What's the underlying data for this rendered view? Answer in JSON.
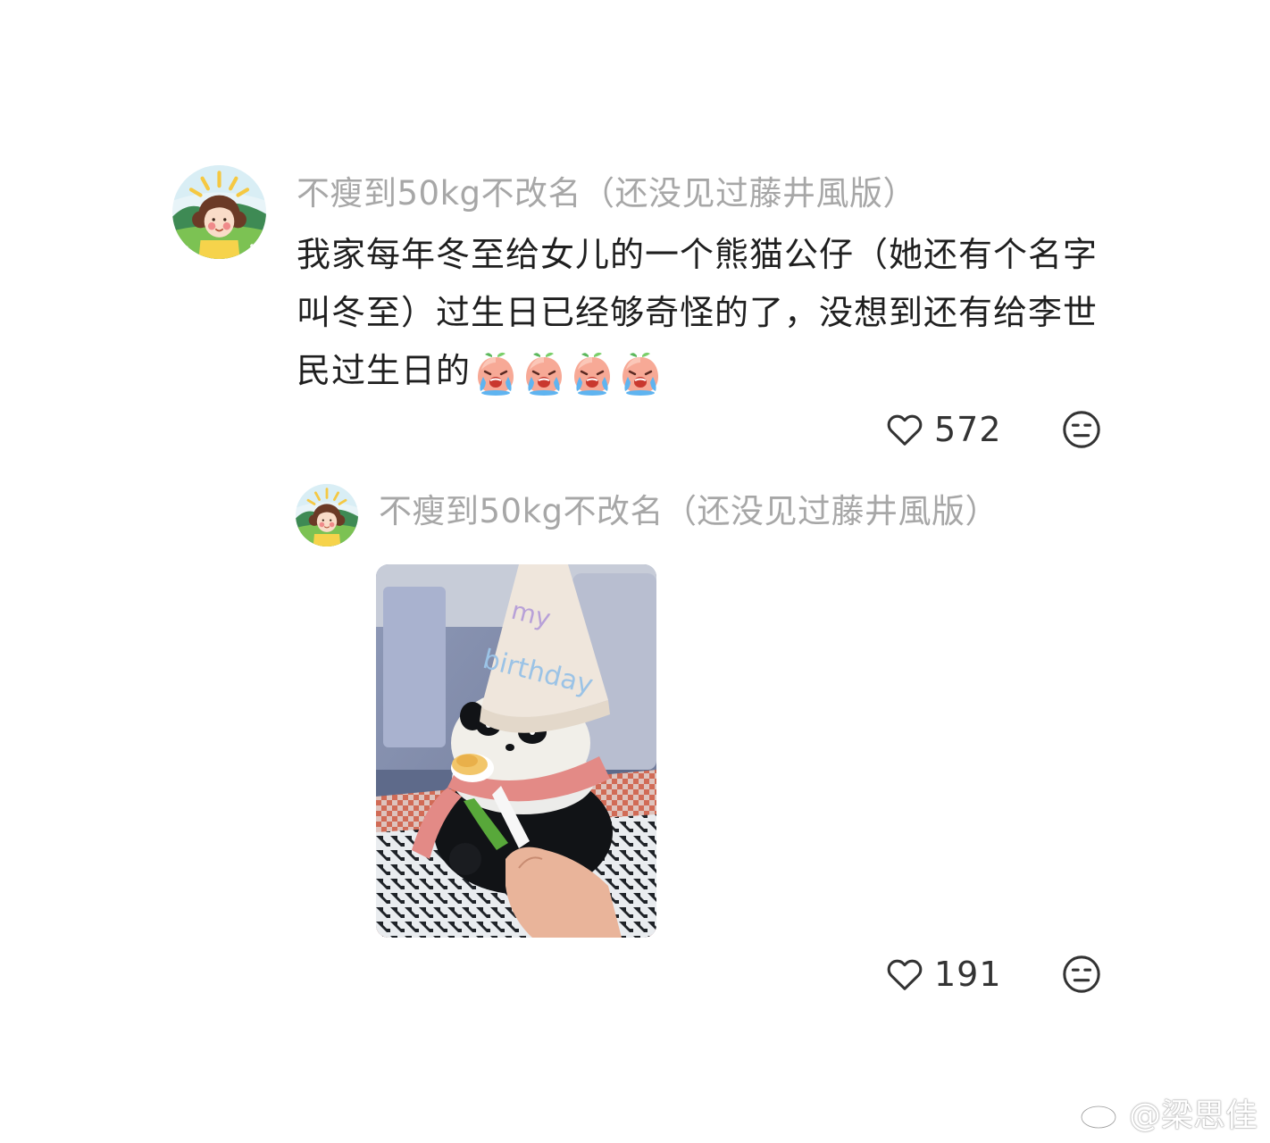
{
  "comments": [
    {
      "username": "不瘦到50kg不改名（还没见过藤井風版）",
      "text": "我家每年冬至给女儿的一个熊猫公仔（她还有个名字叫冬至）过生日已经够奇怪的了，没想到还有给李世民过生日的",
      "emojis": [
        "crying-peach-emoji",
        "crying-peach-emoji",
        "crying-peach-emoji",
        "crying-peach-emoji"
      ],
      "likes": "572"
    },
    {
      "username": "不瘦到50kg不改名（还没见过藤井風版）",
      "image": "panda-plush-birthday-photo",
      "hat_text": "my birthday",
      "likes": "191"
    }
  ],
  "icons": {
    "like": "heart-outline-icon",
    "reaction": "neutral-face-icon"
  },
  "watermark": {
    "text": "@梁思佳",
    "icon": "weibo-logo-icon"
  },
  "colors": {
    "username": "#a7a7a7",
    "text": "#1f1f1f",
    "icon": "#333333"
  }
}
